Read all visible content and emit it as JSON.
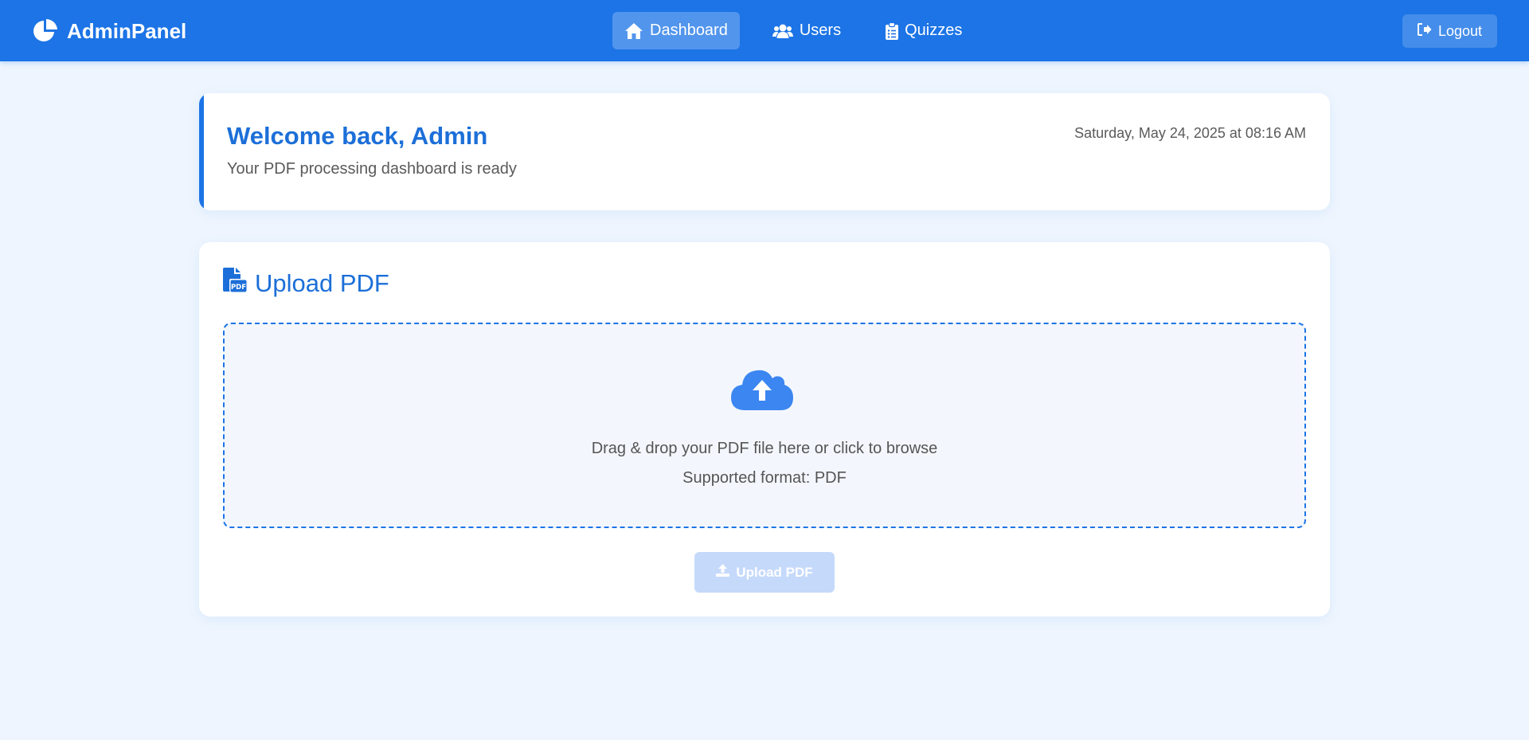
{
  "header": {
    "brand": {
      "name": "AdminPanel",
      "icon": "pie-chart-icon"
    },
    "nav": [
      {
        "label": "Dashboard",
        "icon": "home-icon",
        "active": true
      },
      {
        "label": "Users",
        "icon": "users-icon",
        "active": false
      },
      {
        "label": "Quizzes",
        "icon": "clipboard-list-icon",
        "active": false
      }
    ],
    "logout": {
      "label": "Logout",
      "icon": "sign-out-icon"
    }
  },
  "welcome": {
    "title": "Welcome back, Admin",
    "subtitle": "Your PDF processing dashboard is ready",
    "datetime": "Saturday, May 24, 2025 at 08:16 AM"
  },
  "upload": {
    "title": "Upload PDF",
    "title_icon": "file-pdf-icon",
    "dropzone": {
      "icon": "cloud-upload-icon",
      "text": "Drag & drop your PDF file here or click to browse",
      "subtext": "Supported format: PDF"
    },
    "button": {
      "label": "Upload PDF",
      "icon": "upload-icon",
      "disabled": true
    }
  },
  "colors": {
    "primary": "#1c74e6",
    "background": "#eef5fe",
    "heading": "#1c6fd8",
    "disabled_button": "#c5d9fb"
  }
}
